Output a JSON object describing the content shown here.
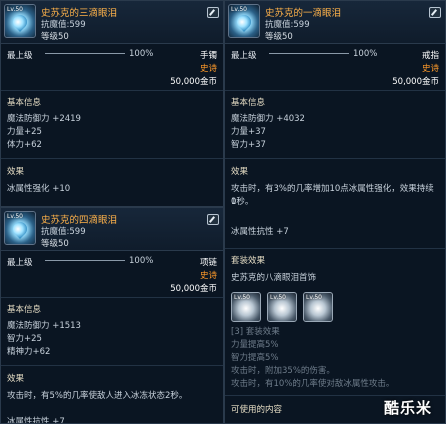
{
  "p1": {
    "level": "Lv.50",
    "name": "史苏克的三滴眼泪",
    "resist_label": "抗魔值",
    "resist_value": ":599",
    "req_level": "等级50",
    "grade_label": "最上级",
    "progress_text": "100%",
    "progress": 1.0,
    "slot": "手镯",
    "rarity": "史诗",
    "price": "50,000金币",
    "base_title": "基本信息",
    "stats": [
      "魔法防御力 +2419",
      "力量+25",
      "体力+62"
    ],
    "effect_title": "效果",
    "effects": [
      "冰属性强化 +10"
    ]
  },
  "p2": {
    "level": "Lv.50",
    "name": "史苏克的一滴眼泪",
    "resist_label": "抗魔值",
    "resist_value": ":599",
    "req_level": "等级50",
    "grade_label": "最上级",
    "progress_text": "100%",
    "progress": 1.0,
    "slot": "戒指",
    "rarity": "史诗",
    "price": "50,000金币",
    "base_title": "基本信息",
    "stats": [
      "魔法防御力 +4032",
      "力量+37",
      "智力+37"
    ],
    "effect_title": "效果",
    "effect_lines": [
      "攻击时，有3%的几率增加10点冰属性强化，效果持续1",
      "0秒。"
    ],
    "effect_extra": "冰属性抗性 +7",
    "set_title": "套装效果",
    "set_name": "史苏克的八滴眼泪首饰",
    "set_icons": [
      {
        "level": "Lv.50"
      },
      {
        "level": "Lv.50"
      },
      {
        "level": "Lv.50"
      }
    ],
    "set_lines": [
      "[3] 套装效果",
      "力量提高5%",
      "智力提高5%",
      "攻击时，附加35%的伤害。",
      "攻击时，有10%的几率使对敌冰属性攻击。"
    ],
    "usable_title": "可使用的内容"
  },
  "p3": {
    "level": "Lv.50",
    "name": "史苏克的四滴眼泪",
    "resist_label": "抗魔值",
    "resist_value": ":599",
    "req_level": "等级50",
    "grade_label": "最上级",
    "progress_text": "100%",
    "progress": 1.0,
    "slot": "项链",
    "rarity": "史诗",
    "price": "50,000金币",
    "base_title": "基本信息",
    "stats": [
      "魔法防御力 +1513",
      "智力+25",
      "精神力+62"
    ],
    "effect_title": "效果",
    "effects": [
      "攻击时，有5%的几率使敌人进入冰冻状态2秒。"
    ],
    "partial_line": "冰属性抗性 +7"
  },
  "watermark": "酷乐米"
}
